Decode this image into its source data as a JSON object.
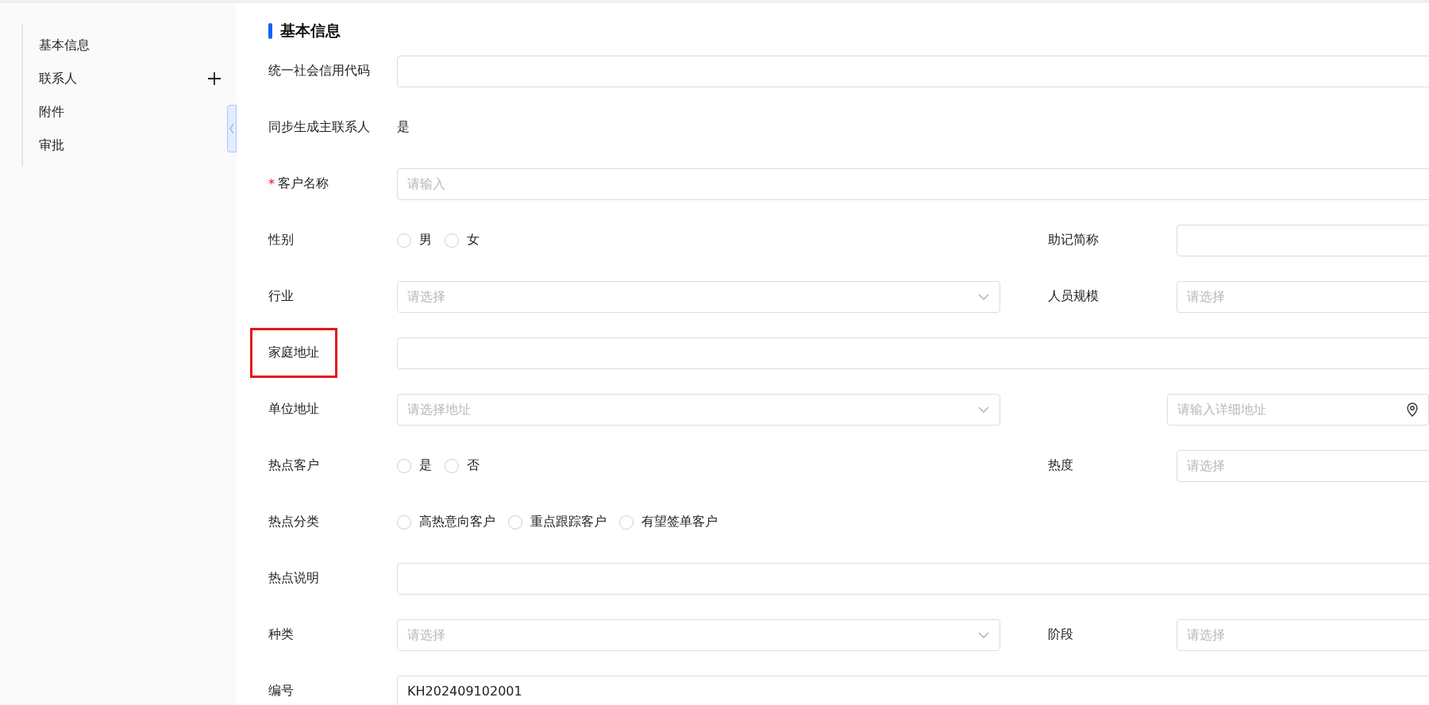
{
  "sidebar": {
    "items": [
      {
        "label": "基本信息",
        "addable": false
      },
      {
        "label": "联系人",
        "addable": true
      },
      {
        "label": "附件",
        "addable": false
      },
      {
        "label": "审批",
        "addable": false
      }
    ]
  },
  "section_title": "基本信息",
  "rows": [
    {
      "fields": [
        {
          "kind": "text",
          "label": "统一社会信用代码"
        }
      ]
    },
    {
      "fields": [
        {
          "kind": "static",
          "label": "同步生成主联系人",
          "value": "是"
        }
      ]
    },
    {
      "fields": [
        {
          "kind": "text",
          "label": "客户名称",
          "required_mark": "*",
          "placeholder": "请输入"
        }
      ]
    },
    {
      "fields": [
        {
          "kind": "radio",
          "label": "性别",
          "options": [
            {
              "label": "男",
              "selected": false
            },
            {
              "label": "女",
              "selected": false
            }
          ]
        },
        {
          "kind": "text",
          "label": "助记简称"
        }
      ]
    },
    {
      "fields": [
        {
          "kind": "select",
          "label": "行业",
          "placeholder": "请选择"
        },
        {
          "kind": "text",
          "label": "人员规模",
          "placeholder": "请选择"
        }
      ]
    },
    {
      "fields": [
        {
          "kind": "text",
          "label": "家庭地址",
          "highlighted": true
        }
      ]
    },
    {
      "fields": [
        {
          "kind": "select",
          "label": "单位地址",
          "placeholder": "请选择地址"
        },
        {
          "kind": "location",
          "placeholder": "请输入详细地址"
        }
      ]
    },
    {
      "fields": [
        {
          "kind": "radio",
          "label": "热点客户",
          "options": [
            {
              "label": "是",
              "selected": false
            },
            {
              "label": "否",
              "selected": false
            }
          ]
        },
        {
          "kind": "text",
          "label": "热度",
          "placeholder": "请选择"
        }
      ]
    },
    {
      "fields": [
        {
          "kind": "radio",
          "label": "热点分类",
          "options": [
            {
              "label": "高热意向客户",
              "selected": false
            },
            {
              "label": "重点跟踪客户",
              "selected": false
            },
            {
              "label": "有望签单客户",
              "selected": false
            }
          ]
        }
      ]
    },
    {
      "fields": [
        {
          "kind": "text",
          "label": "热点说明"
        }
      ]
    },
    {
      "fields": [
        {
          "kind": "select",
          "label": "种类",
          "placeholder": "请选择"
        },
        {
          "kind": "text",
          "label": "阶段",
          "placeholder": "请选择"
        }
      ]
    },
    {
      "fields": [
        {
          "kind": "text",
          "label": "编号",
          "value": "KH202409102001"
        }
      ]
    }
  ]
}
